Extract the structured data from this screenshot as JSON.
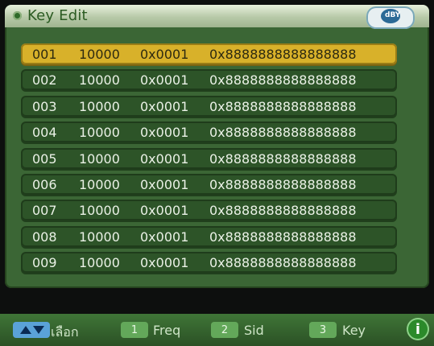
{
  "window": {
    "title": "Key Edit",
    "logo_text": "dBY"
  },
  "rows": [
    {
      "num": "001",
      "freq": "10000",
      "sid": "0x0001",
      "key": "0x8888888888888888"
    },
    {
      "num": "002",
      "freq": "10000",
      "sid": "0x0001",
      "key": "0x8888888888888888"
    },
    {
      "num": "003",
      "freq": "10000",
      "sid": "0x0001",
      "key": "0x8888888888888888"
    },
    {
      "num": "004",
      "freq": "10000",
      "sid": "0x0001",
      "key": "0x8888888888888888"
    },
    {
      "num": "005",
      "freq": "10000",
      "sid": "0x0001",
      "key": "0x8888888888888888"
    },
    {
      "num": "006",
      "freq": "10000",
      "sid": "0x0001",
      "key": "0x8888888888888888"
    },
    {
      "num": "007",
      "freq": "10000",
      "sid": "0x0001",
      "key": "0x8888888888888888"
    },
    {
      "num": "008",
      "freq": "10000",
      "sid": "0x0001",
      "key": "0x8888888888888888"
    },
    {
      "num": "009",
      "freq": "10000",
      "sid": "0x0001",
      "key": "0x8888888888888888"
    }
  ],
  "selected_row": "001",
  "bottom": {
    "select_label": "เลือก",
    "buttons": [
      {
        "number": "1",
        "label": "Freq"
      },
      {
        "number": "2",
        "label": "Sid"
      },
      {
        "number": "3",
        "label": "Key"
      }
    ],
    "info_symbol": "i"
  },
  "colors": {
    "panel": "#3b6635",
    "row": "#2d5428",
    "selected_row": "#d8b12a",
    "button": "#63a85a",
    "arrows": "#5aa2d8"
  },
  "icons": [
    "title-dot-icon",
    "dby-logo-icon",
    "up-down-arrows-icon",
    "info-icon"
  ]
}
